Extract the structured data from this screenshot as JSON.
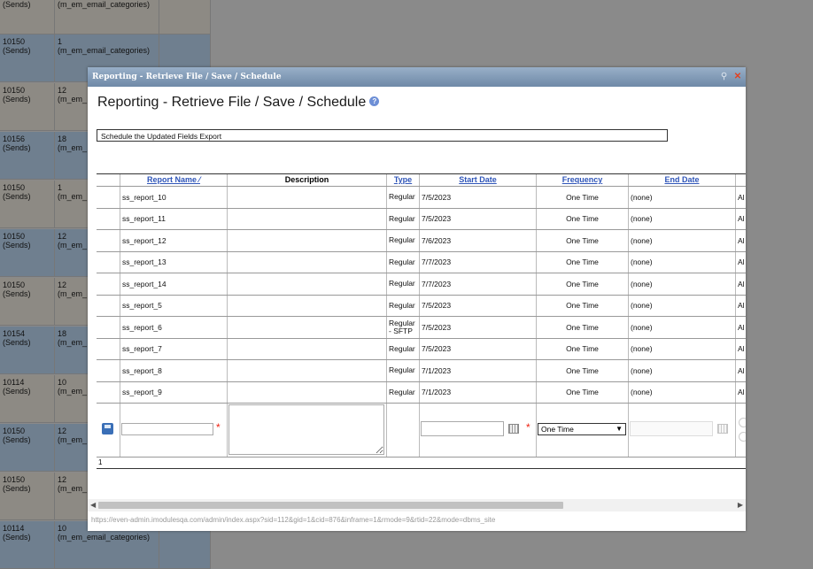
{
  "background_rows": [
    {
      "id": "(Sends)",
      "cat": "(m_em_email_categories)",
      "shade": "tan"
    },
    {
      "id": "10150\n(Sends)",
      "cat": "1\n(m_em_email_categories)",
      "shade": "blue"
    },
    {
      "id": "10150\n(Sends)",
      "cat": "12\n(m_em_",
      "shade": "tan"
    },
    {
      "id": "10156\n(Sends)",
      "cat": "18\n(m_em_",
      "shade": "blue"
    },
    {
      "id": "10150\n(Sends)",
      "cat": "1\n(m_em_",
      "shade": "tan"
    },
    {
      "id": "10150\n(Sends)",
      "cat": "12\n(m_em_",
      "shade": "blue"
    },
    {
      "id": "10150\n(Sends)",
      "cat": "12\n(m_em_",
      "shade": "tan"
    },
    {
      "id": "10154\n(Sends)",
      "cat": "18\n(m_em_",
      "shade": "blue"
    },
    {
      "id": "10114\n(Sends)",
      "cat": "10\n(m_em_",
      "shade": "tan"
    },
    {
      "id": "10150\n(Sends)",
      "cat": "12\n(m_em_",
      "shade": "blue"
    },
    {
      "id": "10150\n(Sends)",
      "cat": "12\n(m_em_",
      "shade": "tan"
    },
    {
      "id": "10114\n(Sends)",
      "cat": "10\n(m_em_email_categories)",
      "shade": "blue"
    }
  ],
  "dialog": {
    "title": "Reporting - Retrieve File / Save / Schedule",
    "heading": "Reporting - Retrieve File / Save / Schedule",
    "schedule_box": "Schedule the Updated Fields Export",
    "status_url": "https://even-admin.imodulesqa.com/admin/index.aspx?sid=112&gid=1&cid=876&inframe=1&rmode=9&rtid=22&mode=dbms_site"
  },
  "columns": {
    "report_name": "Report Name",
    "description": "Description",
    "type": "Type",
    "start_date": "Start Date",
    "frequency": "Frequency",
    "end_date": "End Date"
  },
  "rows": [
    {
      "name": "ss_report_10",
      "type": "Regular",
      "start": "7/5/2023",
      "freq": "One Time",
      "end": "(none)",
      "extra": "Al"
    },
    {
      "name": "ss_report_11",
      "type": "Regular",
      "start": "7/5/2023",
      "freq": "One Time",
      "end": "(none)",
      "extra": "Al"
    },
    {
      "name": "ss_report_12",
      "type": "Regular",
      "start": "7/6/2023",
      "freq": "One Time",
      "end": "(none)",
      "extra": "Al"
    },
    {
      "name": "ss_report_13",
      "type": "Regular",
      "start": "7/7/2023",
      "freq": "One Time",
      "end": "(none)",
      "extra": "Al"
    },
    {
      "name": "ss_report_14",
      "type": "Regular",
      "start": "7/7/2023",
      "freq": "One Time",
      "end": "(none)",
      "extra": "Al"
    },
    {
      "name": "ss_report_5",
      "type": "Regular",
      "start": "7/5/2023",
      "freq": "One Time",
      "end": "(none)",
      "extra": "Al"
    },
    {
      "name": "ss_report_6",
      "type": "Regular\n- SFTP",
      "start": "7/5/2023",
      "freq": "One Time",
      "end": "(none)",
      "extra": "Al"
    },
    {
      "name": "ss_report_7",
      "type": "Regular",
      "start": "7/5/2023",
      "freq": "One Time",
      "end": "(none)",
      "extra": "Al"
    },
    {
      "name": "ss_report_8",
      "type": "Regular",
      "start": "7/1/2023",
      "freq": "One Time",
      "end": "(none)",
      "extra": "Al"
    },
    {
      "name": "ss_report_9",
      "type": "Regular",
      "start": "7/1/2023",
      "freq": "One Time",
      "end": "(none)",
      "extra": "Al"
    }
  ],
  "new_row": {
    "frequency_selected": "One Time",
    "required_mark": "*"
  },
  "pager": {
    "page": "1"
  }
}
